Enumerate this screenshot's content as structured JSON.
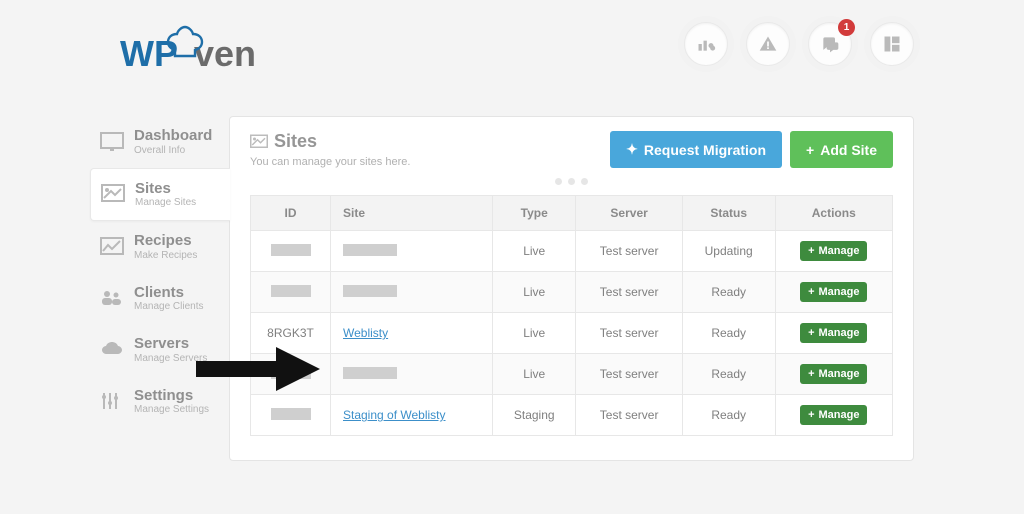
{
  "brand": {
    "text1": "WP",
    "text2": "ven"
  },
  "notifications": {
    "badge": "1"
  },
  "nav": {
    "dashboard": {
      "title": "Dashboard",
      "sub": "Overall Info"
    },
    "sites": {
      "title": "Sites",
      "sub": "Manage Sites"
    },
    "recipes": {
      "title": "Recipes",
      "sub": "Make Recipes"
    },
    "clients": {
      "title": "Clients",
      "sub": "Manage Clients"
    },
    "servers": {
      "title": "Servers",
      "sub": "Manage Servers"
    },
    "settings": {
      "title": "Settings",
      "sub": "Manage Settings"
    }
  },
  "page": {
    "title": "Sites",
    "subtitle": "You can manage your sites here.",
    "request_migration": "Request Migration",
    "add_site": "Add Site"
  },
  "table": {
    "headers": {
      "id": "ID",
      "site": "Site",
      "type": "Type",
      "server": "Server",
      "status": "Status",
      "actions": "Actions"
    },
    "manage_label": "Manage",
    "rows": [
      {
        "id": "",
        "site": "",
        "type": "Live",
        "server": "Test server",
        "status": "Updating"
      },
      {
        "id": "",
        "site": "",
        "type": "Live",
        "server": "Test server",
        "status": "Ready"
      },
      {
        "id": "8RGK3T",
        "site": "Weblisty",
        "type": "Live",
        "server": "Test server",
        "status": "Ready"
      },
      {
        "id": "",
        "site": "",
        "type": "Live",
        "server": "Test server",
        "status": "Ready"
      },
      {
        "id": "",
        "site": "Staging of Weblisty",
        "type": "Staging",
        "server": "Test server",
        "status": "Ready"
      }
    ]
  }
}
